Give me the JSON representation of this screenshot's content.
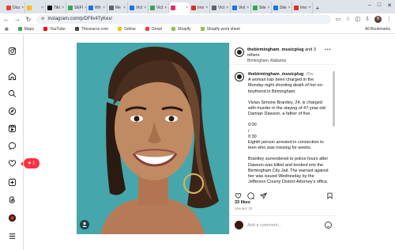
{
  "browser": {
    "tabs": [
      {
        "label": "Dou",
        "color": "#ea4335"
      },
      {
        "label": "",
        "color": "#fbbc05"
      },
      {
        "label": "TikI",
        "color": "#111111"
      },
      {
        "label": "SEFI",
        "color": "#34a853"
      },
      {
        "label": "Wh",
        "color": "#1a73e8"
      },
      {
        "label": "Me",
        "color": "#5f6368"
      },
      {
        "label": "Vict",
        "color": "#1a73e8"
      },
      {
        "label": "Vict",
        "color": "#34a853"
      },
      {
        "label": "",
        "color": "#e1306c",
        "active": true
      },
      {
        "label": "Imo",
        "color": "#d93025"
      },
      {
        "label": "Vict",
        "color": "#5f6368"
      },
      {
        "label": "Viol",
        "color": "#1a73e8"
      },
      {
        "label": "Site",
        "color": "#34a853"
      },
      {
        "label": "Site",
        "color": "#1a73e8"
      },
      {
        "label": "Imo",
        "color": "#d93025"
      }
    ],
    "address": "instagram.com/p/DFlIv4TyKex/",
    "bookmarks": [
      {
        "label": "Maps",
        "color": "#34a853"
      },
      {
        "label": "YouTube",
        "color": "#ff0000"
      },
      {
        "label": "Thesource.com",
        "color": "#444444"
      },
      {
        "label": "Gdrive",
        "color": "#fbbc05"
      },
      {
        "label": "Gmail",
        "color": "#ea4335"
      },
      {
        "label": "Shopify",
        "color": "#95bf47"
      },
      {
        "label": "Shopify work sheet",
        "color": "#95bf47"
      }
    ],
    "all_bookmarks": "All Bookmarks",
    "profile_initial": "N"
  },
  "notification": {
    "count": "1"
  },
  "post": {
    "author": "thebirmingham_musicplug",
    "coauthors_suffix": " and 3 others",
    "location": "Birmingham, Alabama",
    "caption_author": "thebirmingham_musicplug",
    "caption_age": "20w",
    "caption_paragraphs": [
      "A woman has been charged in the Monday night shooting death of her ex-boyfriend in Birmingham.",
      "Vivian Simone Brantley, 24, is charged with murder in the slaying of 47-year-old Damian Dawson, a father of five.",
      "0:00\n/\n0:30\nEighth person arrested in connection to teen who was missing for weeks.",
      "Brantley surrendered to police hours after Dawson was killed and booked into the Birmingham City Jail. The warrant against her was issued Wednesday by the Jefferson County District Attorney's office."
    ],
    "likes": "33 likes",
    "date": "January 30",
    "comment_placeholder": "Add a comment..."
  }
}
